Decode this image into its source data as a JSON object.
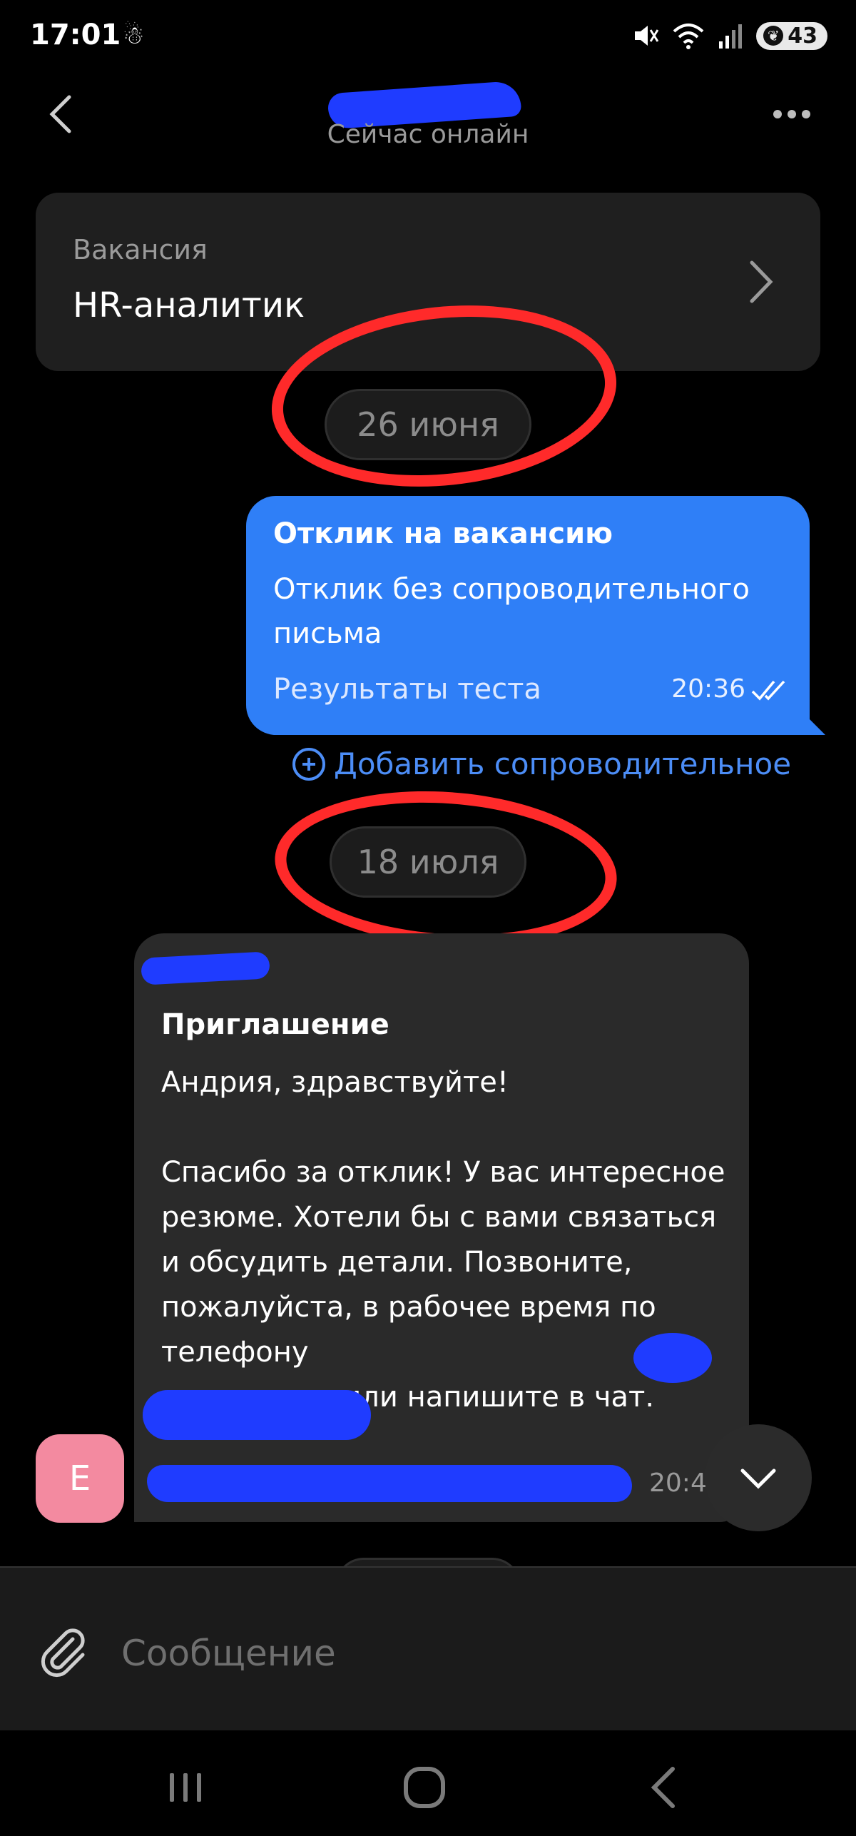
{
  "status_bar": {
    "time": "17:01",
    "extra_icon": "☃",
    "battery_level": "43",
    "icons": [
      "mute-icon",
      "wifi-icon",
      "signal-icon",
      "battery-icon"
    ]
  },
  "header": {
    "contact_name": "",
    "online_status": "Сейчас онлайн"
  },
  "vacancy": {
    "label": "Вакансия",
    "title": "HR-аналитик"
  },
  "dates": {
    "first": "26 июня",
    "second": "18 июля"
  },
  "outgoing_message": {
    "title": "Отклик на вакансию",
    "body": "Отклик без сопроводительного письма",
    "footer": "Результаты теста",
    "time": "20:36"
  },
  "add_cover_letter": "Добавить сопроводительное",
  "incoming_message": {
    "title": "Приглашение",
    "body": "Андрия, здравствуйте!\n\nСпасибо за отклик! У вас интересное резюме. Хотели бы с вами связаться и обсудить детали. Позвоните, пожалуйста, в рабочее время по телефону\n                    или напишите в чат.",
    "time": "20:4"
  },
  "avatar_letter": "E",
  "composer": {
    "placeholder": "Сообщение"
  },
  "colors": {
    "outgoing_bubble": "#2f7ff7",
    "incoming_bubble": "#2a2a2a",
    "accent_link": "#4c8df6",
    "annotation_red": "#ff2a2a",
    "avatar": "#f38aa0"
  }
}
